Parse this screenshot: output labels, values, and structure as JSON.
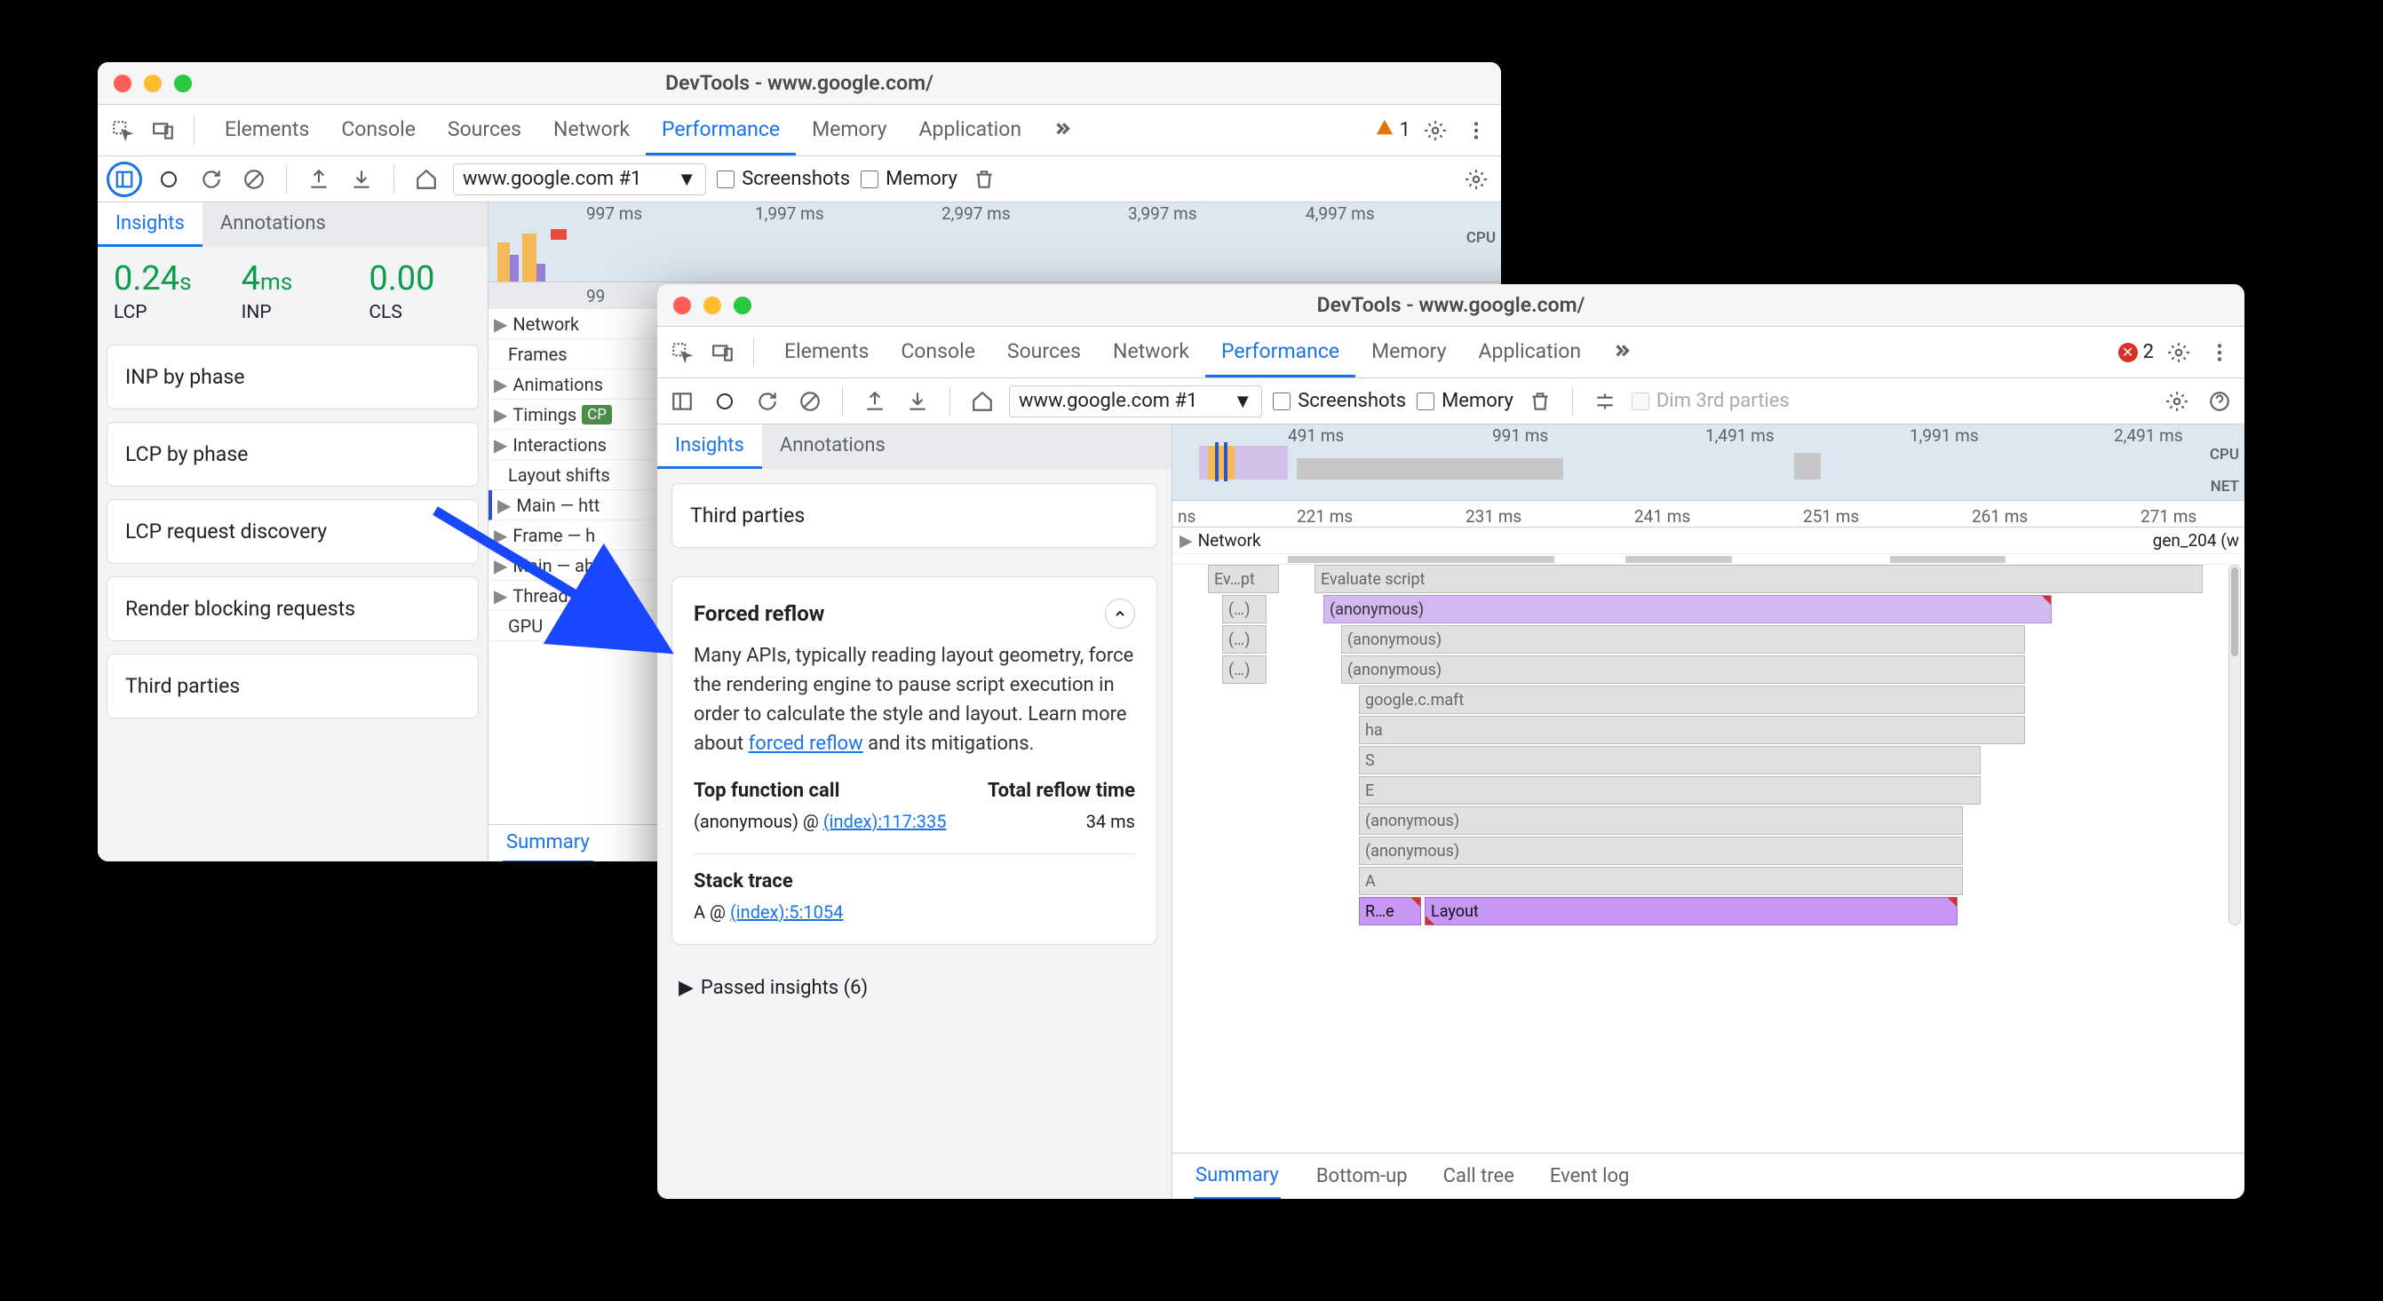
{
  "windowA": {
    "title": "DevTools - www.google.com/",
    "tabs": [
      "Elements",
      "Console",
      "Sources",
      "Network",
      "Performance",
      "Memory",
      "Application"
    ],
    "activeTab": "Performance",
    "warnCount": "1",
    "subbar": {
      "url": "www.google.com #1",
      "screenshots": "Screenshots",
      "memory": "Memory"
    },
    "sideTabs": {
      "insights": "Insights",
      "annotations": "Annotations"
    },
    "metrics": {
      "lcp_val": "0.24",
      "lcp_unit": "s",
      "lcp_lbl": "LCP",
      "inp_val": "4",
      "inp_unit": "ms",
      "inp_lbl": "INP",
      "cls_val": "0.00",
      "cls_unit": "",
      "cls_lbl": "CLS"
    },
    "insights": [
      "INP by phase",
      "LCP by phase",
      "LCP request discovery",
      "Render blocking requests",
      "Third parties"
    ],
    "ruler": [
      "997 ms",
      "1,997 ms",
      "2,997 ms",
      "3,997 ms",
      "4,997 ms"
    ],
    "cpu": "CPU",
    "ruler2": "99",
    "tracks": {
      "network": "Network",
      "frames": "Frames",
      "animations": "Animations",
      "timings": "Timings",
      "timingsChip": "CP",
      "interactions": "Interactions",
      "layoutShifts": "Layout shifts",
      "main": "Main — htt",
      "frame": "Frame — h",
      "main2": "Main — ab",
      "threadpool": "Thread pool",
      "gpu": "GPU"
    },
    "summaryTab": "Summary"
  },
  "windowB": {
    "title": "DevTools - www.google.com/",
    "tabs": [
      "Elements",
      "Console",
      "Sources",
      "Network",
      "Performance",
      "Memory",
      "Application"
    ],
    "activeTab": "Performance",
    "errCount": "2",
    "subbar": {
      "url": "www.google.com #1",
      "screenshots": "Screenshots",
      "memory": "Memory",
      "dim": "Dim 3rd parties"
    },
    "sideTabs": {
      "insights": "Insights",
      "annotations": "Annotations"
    },
    "thirdParties": "Third parties",
    "detail": {
      "title": "Forced reflow",
      "body1": "Many APIs, typically reading layout geometry, force the rendering engine to pause script execution in order to calculate the style and layout. Learn more about ",
      "link": "forced reflow",
      "body2": " and its mitigations.",
      "col1_h": "Top function call",
      "col1_v": "(anonymous) @ ",
      "col1_link": "(index):117:335",
      "col2_h": "Total reflow time",
      "col2_v": "34 ms",
      "stack_h": "Stack trace",
      "stack_v": "A @ ",
      "stack_link": "(index):5:1054"
    },
    "passed": "Passed insights (6)",
    "overviewRuler": [
      "491 ms",
      "991 ms",
      "1,491 ms",
      "1,991 ms",
      "2,491 ms"
    ],
    "cpu": "CPU",
    "net": "NET",
    "flameRulerStart": "ns",
    "flameRuler": [
      "221 ms",
      "231 ms",
      "241 ms",
      "251 ms",
      "261 ms",
      "271 ms"
    ],
    "networkRow": "Network",
    "gen204": "gen_204 (w",
    "flameStack": {
      "evpt": "Ev…pt",
      "dots": "(…)",
      "evalScript": "Evaluate script",
      "anon": "(anonymous)",
      "maft": "google.c.maft",
      "ha": "ha",
      "S": "S",
      "E": "E",
      "A": "A",
      "Re": "R…e",
      "Layout": "Layout"
    },
    "bottomTabs": [
      "Summary",
      "Bottom-up",
      "Call tree",
      "Event log"
    ]
  }
}
